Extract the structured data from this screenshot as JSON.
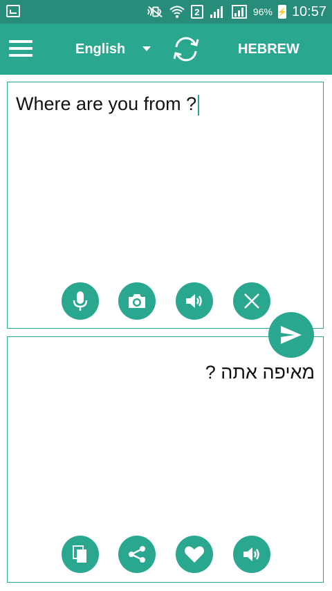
{
  "status_bar": {
    "sim_slot": "2",
    "battery_percent": "96%",
    "time": "10:57",
    "icons": [
      "screenshot-icon",
      "mute-vibrate-icon",
      "wifi-icon",
      "signal-icon",
      "signal-icon",
      "battery-charging-icon"
    ]
  },
  "toolbar": {
    "menu_icon": "hamburger-menu-icon",
    "source_language": "English",
    "dropdown_icon": "dropdown-arrow-icon",
    "swap_icon": "swap-languages-icon",
    "target_language": "HEBREW"
  },
  "input": {
    "text": "Where are you from ?",
    "buttons": [
      "microphone-icon",
      "camera-icon",
      "speaker-icon",
      "clear-icon"
    ]
  },
  "send": {
    "icon": "send-icon"
  },
  "output": {
    "text": "מאיפה אתה ?",
    "buttons": [
      "copy-icon",
      "share-icon",
      "favorite-heart-icon",
      "speaker-icon"
    ]
  },
  "colors": {
    "status_bar": "#278d7a",
    "toolbar": "#2aa78f",
    "accent": "#2aa78f",
    "text": "#111111"
  }
}
